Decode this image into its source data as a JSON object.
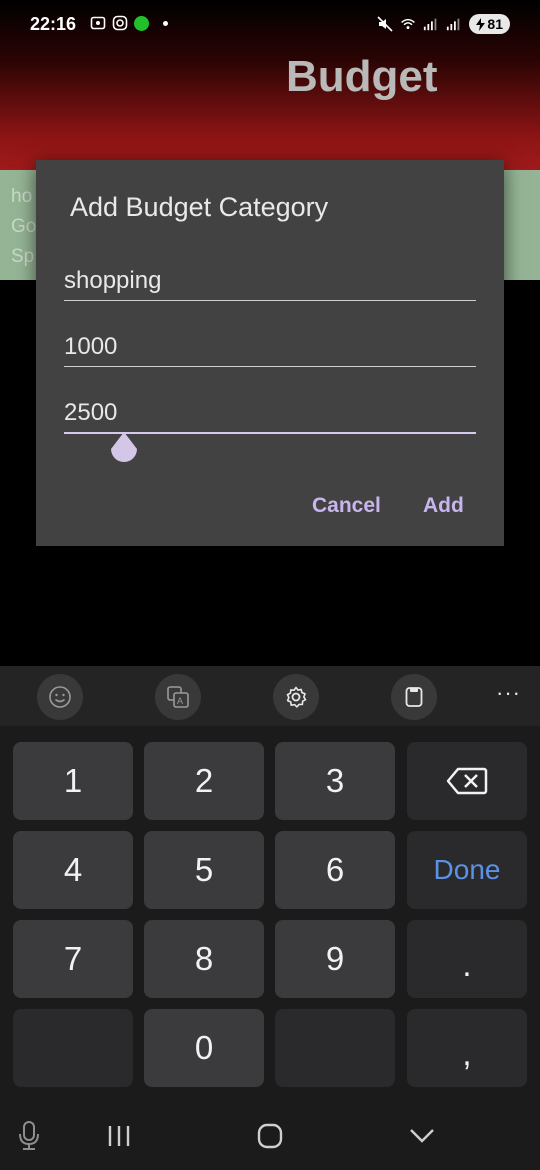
{
  "status": {
    "time": "22:16",
    "battery": "81"
  },
  "app": {
    "title": "Budget",
    "background_items": [
      "ho",
      "Go",
      "Sp"
    ]
  },
  "dialog": {
    "title": "Add Budget Category",
    "fields": {
      "name": "shopping",
      "amount": "1000",
      "limit": "2500"
    },
    "buttons": {
      "cancel": "Cancel",
      "add": "Add"
    }
  },
  "keyboard": {
    "toolbar": [
      "emoji-icon",
      "translate-icon",
      "settings-icon",
      "clipboard-icon"
    ],
    "more": "···",
    "keys": {
      "k1": "1",
      "k2": "2",
      "k3": "3",
      "k4": "4",
      "k5": "5",
      "k6": "6",
      "k7": "7",
      "k8": "8",
      "k9": "9",
      "k0": "0",
      "done": "Done",
      "period": ".",
      "comma": ","
    }
  }
}
